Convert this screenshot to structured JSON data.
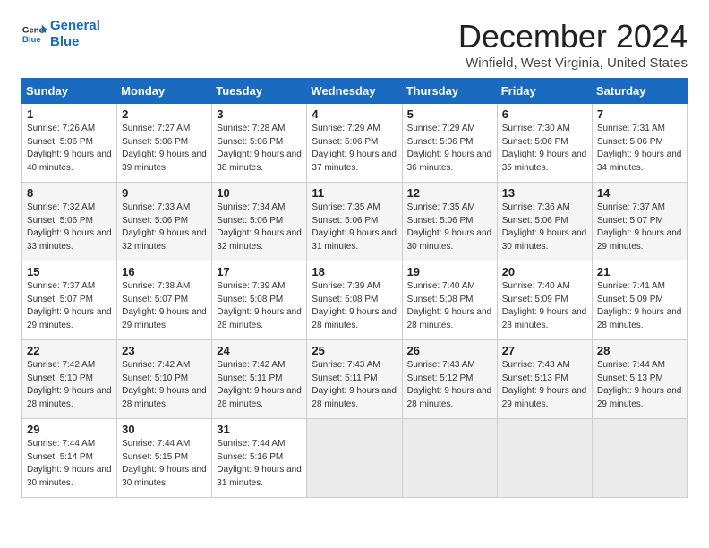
{
  "header": {
    "logo_line1": "General",
    "logo_line2": "Blue",
    "month_title": "December 2024",
    "location": "Winfield, West Virginia, United States"
  },
  "weekdays": [
    "Sunday",
    "Monday",
    "Tuesday",
    "Wednesday",
    "Thursday",
    "Friday",
    "Saturday"
  ],
  "weeks": [
    [
      {
        "day": "1",
        "sunrise": "Sunrise: 7:26 AM",
        "sunset": "Sunset: 5:06 PM",
        "daylight": "Daylight: 9 hours and 40 minutes."
      },
      {
        "day": "2",
        "sunrise": "Sunrise: 7:27 AM",
        "sunset": "Sunset: 5:06 PM",
        "daylight": "Daylight: 9 hours and 39 minutes."
      },
      {
        "day": "3",
        "sunrise": "Sunrise: 7:28 AM",
        "sunset": "Sunset: 5:06 PM",
        "daylight": "Daylight: 9 hours and 38 minutes."
      },
      {
        "day": "4",
        "sunrise": "Sunrise: 7:29 AM",
        "sunset": "Sunset: 5:06 PM",
        "daylight": "Daylight: 9 hours and 37 minutes."
      },
      {
        "day": "5",
        "sunrise": "Sunrise: 7:29 AM",
        "sunset": "Sunset: 5:06 PM",
        "daylight": "Daylight: 9 hours and 36 minutes."
      },
      {
        "day": "6",
        "sunrise": "Sunrise: 7:30 AM",
        "sunset": "Sunset: 5:06 PM",
        "daylight": "Daylight: 9 hours and 35 minutes."
      },
      {
        "day": "7",
        "sunrise": "Sunrise: 7:31 AM",
        "sunset": "Sunset: 5:06 PM",
        "daylight": "Daylight: 9 hours and 34 minutes."
      }
    ],
    [
      {
        "day": "8",
        "sunrise": "Sunrise: 7:32 AM",
        "sunset": "Sunset: 5:06 PM",
        "daylight": "Daylight: 9 hours and 33 minutes."
      },
      {
        "day": "9",
        "sunrise": "Sunrise: 7:33 AM",
        "sunset": "Sunset: 5:06 PM",
        "daylight": "Daylight: 9 hours and 32 minutes."
      },
      {
        "day": "10",
        "sunrise": "Sunrise: 7:34 AM",
        "sunset": "Sunset: 5:06 PM",
        "daylight": "Daylight: 9 hours and 32 minutes."
      },
      {
        "day": "11",
        "sunrise": "Sunrise: 7:35 AM",
        "sunset": "Sunset: 5:06 PM",
        "daylight": "Daylight: 9 hours and 31 minutes."
      },
      {
        "day": "12",
        "sunrise": "Sunrise: 7:35 AM",
        "sunset": "Sunset: 5:06 PM",
        "daylight": "Daylight: 9 hours and 30 minutes."
      },
      {
        "day": "13",
        "sunrise": "Sunrise: 7:36 AM",
        "sunset": "Sunset: 5:06 PM",
        "daylight": "Daylight: 9 hours and 30 minutes."
      },
      {
        "day": "14",
        "sunrise": "Sunrise: 7:37 AM",
        "sunset": "Sunset: 5:07 PM",
        "daylight": "Daylight: 9 hours and 29 minutes."
      }
    ],
    [
      {
        "day": "15",
        "sunrise": "Sunrise: 7:37 AM",
        "sunset": "Sunset: 5:07 PM",
        "daylight": "Daylight: 9 hours and 29 minutes."
      },
      {
        "day": "16",
        "sunrise": "Sunrise: 7:38 AM",
        "sunset": "Sunset: 5:07 PM",
        "daylight": "Daylight: 9 hours and 29 minutes."
      },
      {
        "day": "17",
        "sunrise": "Sunrise: 7:39 AM",
        "sunset": "Sunset: 5:08 PM",
        "daylight": "Daylight: 9 hours and 28 minutes."
      },
      {
        "day": "18",
        "sunrise": "Sunrise: 7:39 AM",
        "sunset": "Sunset: 5:08 PM",
        "daylight": "Daylight: 9 hours and 28 minutes."
      },
      {
        "day": "19",
        "sunrise": "Sunrise: 7:40 AM",
        "sunset": "Sunset: 5:08 PM",
        "daylight": "Daylight: 9 hours and 28 minutes."
      },
      {
        "day": "20",
        "sunrise": "Sunrise: 7:40 AM",
        "sunset": "Sunset: 5:09 PM",
        "daylight": "Daylight: 9 hours and 28 minutes."
      },
      {
        "day": "21",
        "sunrise": "Sunrise: 7:41 AM",
        "sunset": "Sunset: 5:09 PM",
        "daylight": "Daylight: 9 hours and 28 minutes."
      }
    ],
    [
      {
        "day": "22",
        "sunrise": "Sunrise: 7:42 AM",
        "sunset": "Sunset: 5:10 PM",
        "daylight": "Daylight: 9 hours and 28 minutes."
      },
      {
        "day": "23",
        "sunrise": "Sunrise: 7:42 AM",
        "sunset": "Sunset: 5:10 PM",
        "daylight": "Daylight: 9 hours and 28 minutes."
      },
      {
        "day": "24",
        "sunrise": "Sunrise: 7:42 AM",
        "sunset": "Sunset: 5:11 PM",
        "daylight": "Daylight: 9 hours and 28 minutes."
      },
      {
        "day": "25",
        "sunrise": "Sunrise: 7:43 AM",
        "sunset": "Sunset: 5:11 PM",
        "daylight": "Daylight: 9 hours and 28 minutes."
      },
      {
        "day": "26",
        "sunrise": "Sunrise: 7:43 AM",
        "sunset": "Sunset: 5:12 PM",
        "daylight": "Daylight: 9 hours and 28 minutes."
      },
      {
        "day": "27",
        "sunrise": "Sunrise: 7:43 AM",
        "sunset": "Sunset: 5:13 PM",
        "daylight": "Daylight: 9 hours and 29 minutes."
      },
      {
        "day": "28",
        "sunrise": "Sunrise: 7:44 AM",
        "sunset": "Sunset: 5:13 PM",
        "daylight": "Daylight: 9 hours and 29 minutes."
      }
    ],
    [
      {
        "day": "29",
        "sunrise": "Sunrise: 7:44 AM",
        "sunset": "Sunset: 5:14 PM",
        "daylight": "Daylight: 9 hours and 30 minutes."
      },
      {
        "day": "30",
        "sunrise": "Sunrise: 7:44 AM",
        "sunset": "Sunset: 5:15 PM",
        "daylight": "Daylight: 9 hours and 30 minutes."
      },
      {
        "day": "31",
        "sunrise": "Sunrise: 7:44 AM",
        "sunset": "Sunset: 5:16 PM",
        "daylight": "Daylight: 9 hours and 31 minutes."
      },
      null,
      null,
      null,
      null
    ]
  ]
}
